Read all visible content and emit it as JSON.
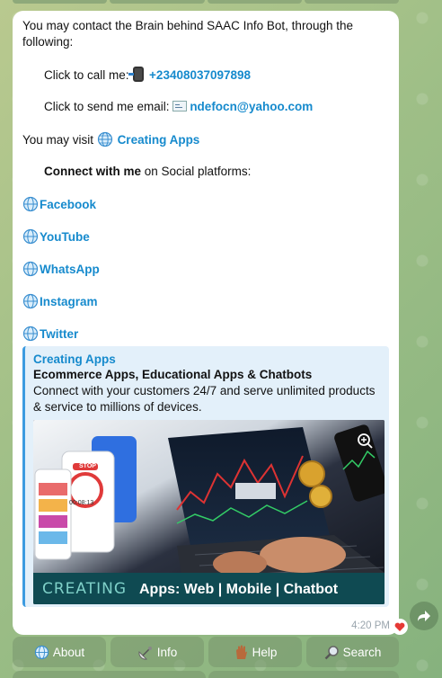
{
  "message": {
    "intro": "You may contact the Brain behind SAAC Info Bot, through the following:",
    "call_label": "Click to call me: ",
    "phone": "+23408037097898",
    "email_label": "Click to send me email: ",
    "email": "ndefocn@yahoo.com",
    "visit_label": "You may visit ",
    "visit_link": "Creating Apps",
    "connect_bold": "Connect with me",
    "connect_rest": " on Social platforms:",
    "social": [
      "Facebook",
      "YouTube",
      "WhatsApp",
      "Instagram",
      "Twitter"
    ],
    "time": "4:20 PM"
  },
  "preview": {
    "site": "Creating Apps",
    "title": "Ecommerce Apps, Educational Apps & Chatbots",
    "description": "Connect with your customers 24/7 and serve unlimited products & service to millions of devices.",
    "banner_brand": "CREATING",
    "banner_text": "Apps: Web | Mobile | Chatbot",
    "phone_screen_time": "00:08:13",
    "phone_screen_button": "STOP"
  },
  "keyboard": {
    "buttons": [
      {
        "label": "About",
        "icon": "globe-icon"
      },
      {
        "label": "Info",
        "icon": "satellite-icon"
      },
      {
        "label": "Help",
        "icon": "raised-hand-icon"
      },
      {
        "label": "Search",
        "icon": "magnifier-icon"
      }
    ]
  },
  "colors": {
    "link": "#168acd",
    "preview_bg": "#e3f0fa",
    "preview_bar": "#3c9be0",
    "heart": "#e53935"
  }
}
